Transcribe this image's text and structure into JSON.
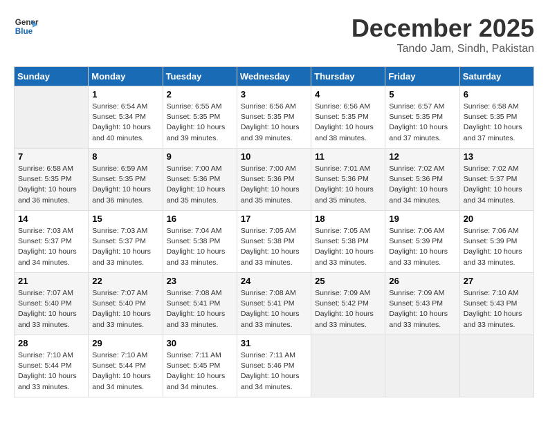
{
  "header": {
    "logo_line1": "General",
    "logo_line2": "Blue",
    "month": "December 2025",
    "location": "Tando Jam, Sindh, Pakistan"
  },
  "weekdays": [
    "Sunday",
    "Monday",
    "Tuesday",
    "Wednesday",
    "Thursday",
    "Friday",
    "Saturday"
  ],
  "weeks": [
    [
      {
        "day": "",
        "info": ""
      },
      {
        "day": "1",
        "info": "Sunrise: 6:54 AM\nSunset: 5:34 PM\nDaylight: 10 hours\nand 40 minutes."
      },
      {
        "day": "2",
        "info": "Sunrise: 6:55 AM\nSunset: 5:35 PM\nDaylight: 10 hours\nand 39 minutes."
      },
      {
        "day": "3",
        "info": "Sunrise: 6:56 AM\nSunset: 5:35 PM\nDaylight: 10 hours\nand 39 minutes."
      },
      {
        "day": "4",
        "info": "Sunrise: 6:56 AM\nSunset: 5:35 PM\nDaylight: 10 hours\nand 38 minutes."
      },
      {
        "day": "5",
        "info": "Sunrise: 6:57 AM\nSunset: 5:35 PM\nDaylight: 10 hours\nand 37 minutes."
      },
      {
        "day": "6",
        "info": "Sunrise: 6:58 AM\nSunset: 5:35 PM\nDaylight: 10 hours\nand 37 minutes."
      }
    ],
    [
      {
        "day": "7",
        "info": "Sunrise: 6:58 AM\nSunset: 5:35 PM\nDaylight: 10 hours\nand 36 minutes."
      },
      {
        "day": "8",
        "info": "Sunrise: 6:59 AM\nSunset: 5:35 PM\nDaylight: 10 hours\nand 36 minutes."
      },
      {
        "day": "9",
        "info": "Sunrise: 7:00 AM\nSunset: 5:36 PM\nDaylight: 10 hours\nand 35 minutes."
      },
      {
        "day": "10",
        "info": "Sunrise: 7:00 AM\nSunset: 5:36 PM\nDaylight: 10 hours\nand 35 minutes."
      },
      {
        "day": "11",
        "info": "Sunrise: 7:01 AM\nSunset: 5:36 PM\nDaylight: 10 hours\nand 35 minutes."
      },
      {
        "day": "12",
        "info": "Sunrise: 7:02 AM\nSunset: 5:36 PM\nDaylight: 10 hours\nand 34 minutes."
      },
      {
        "day": "13",
        "info": "Sunrise: 7:02 AM\nSunset: 5:37 PM\nDaylight: 10 hours\nand 34 minutes."
      }
    ],
    [
      {
        "day": "14",
        "info": "Sunrise: 7:03 AM\nSunset: 5:37 PM\nDaylight: 10 hours\nand 34 minutes."
      },
      {
        "day": "15",
        "info": "Sunrise: 7:03 AM\nSunset: 5:37 PM\nDaylight: 10 hours\nand 33 minutes."
      },
      {
        "day": "16",
        "info": "Sunrise: 7:04 AM\nSunset: 5:38 PM\nDaylight: 10 hours\nand 33 minutes."
      },
      {
        "day": "17",
        "info": "Sunrise: 7:05 AM\nSunset: 5:38 PM\nDaylight: 10 hours\nand 33 minutes."
      },
      {
        "day": "18",
        "info": "Sunrise: 7:05 AM\nSunset: 5:38 PM\nDaylight: 10 hours\nand 33 minutes."
      },
      {
        "day": "19",
        "info": "Sunrise: 7:06 AM\nSunset: 5:39 PM\nDaylight: 10 hours\nand 33 minutes."
      },
      {
        "day": "20",
        "info": "Sunrise: 7:06 AM\nSunset: 5:39 PM\nDaylight: 10 hours\nand 33 minutes."
      }
    ],
    [
      {
        "day": "21",
        "info": "Sunrise: 7:07 AM\nSunset: 5:40 PM\nDaylight: 10 hours\nand 33 minutes."
      },
      {
        "day": "22",
        "info": "Sunrise: 7:07 AM\nSunset: 5:40 PM\nDaylight: 10 hours\nand 33 minutes."
      },
      {
        "day": "23",
        "info": "Sunrise: 7:08 AM\nSunset: 5:41 PM\nDaylight: 10 hours\nand 33 minutes."
      },
      {
        "day": "24",
        "info": "Sunrise: 7:08 AM\nSunset: 5:41 PM\nDaylight: 10 hours\nand 33 minutes."
      },
      {
        "day": "25",
        "info": "Sunrise: 7:09 AM\nSunset: 5:42 PM\nDaylight: 10 hours\nand 33 minutes."
      },
      {
        "day": "26",
        "info": "Sunrise: 7:09 AM\nSunset: 5:43 PM\nDaylight: 10 hours\nand 33 minutes."
      },
      {
        "day": "27",
        "info": "Sunrise: 7:10 AM\nSunset: 5:43 PM\nDaylight: 10 hours\nand 33 minutes."
      }
    ],
    [
      {
        "day": "28",
        "info": "Sunrise: 7:10 AM\nSunset: 5:44 PM\nDaylight: 10 hours\nand 33 minutes."
      },
      {
        "day": "29",
        "info": "Sunrise: 7:10 AM\nSunset: 5:44 PM\nDaylight: 10 hours\nand 34 minutes."
      },
      {
        "day": "30",
        "info": "Sunrise: 7:11 AM\nSunset: 5:45 PM\nDaylight: 10 hours\nand 34 minutes."
      },
      {
        "day": "31",
        "info": "Sunrise: 7:11 AM\nSunset: 5:46 PM\nDaylight: 10 hours\nand 34 minutes."
      },
      {
        "day": "",
        "info": ""
      },
      {
        "day": "",
        "info": ""
      },
      {
        "day": "",
        "info": ""
      }
    ]
  ]
}
